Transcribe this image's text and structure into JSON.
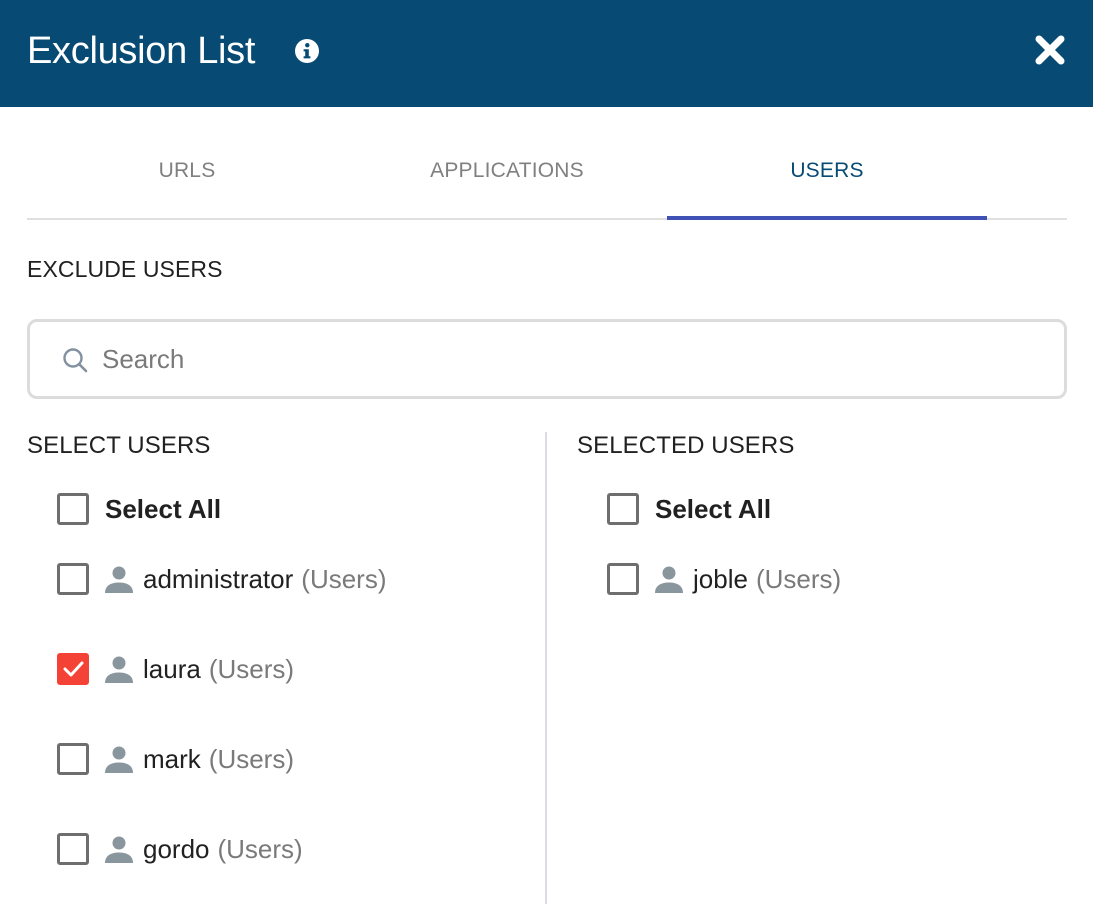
{
  "header": {
    "title": "Exclusion List",
    "info_icon": "info-circle-icon",
    "close_icon": "close-x-icon",
    "background": "#074b74"
  },
  "tabs": [
    {
      "label": "URLS",
      "active": false
    },
    {
      "label": "APPLICATIONS",
      "active": false
    },
    {
      "label": "USERS",
      "active": true
    }
  ],
  "tab_indicator_color": "#3f51b5",
  "section_title": "EXCLUDE USERS",
  "search": {
    "placeholder": "Search",
    "value": "",
    "icon": "search-icon"
  },
  "select_users": {
    "title": "SELECT USERS",
    "select_all_label": "Select All",
    "select_all_checked": false,
    "items": [
      {
        "name": "administrator",
        "group": "(Users)",
        "checked": false
      },
      {
        "name": "laura",
        "group": "(Users)",
        "checked": true
      },
      {
        "name": "mark",
        "group": "(Users)",
        "checked": false
      },
      {
        "name": "gordo",
        "group": "(Users)",
        "checked": false
      }
    ]
  },
  "selected_users": {
    "title": "SELECTED USERS",
    "select_all_label": "Select All",
    "select_all_checked": false,
    "items": [
      {
        "name": "joble",
        "group": "(Users)",
        "checked": false
      }
    ]
  },
  "colors": {
    "checked": "#f44336",
    "user_icon": "#8a969e",
    "active_tab_text": "#074b74"
  }
}
